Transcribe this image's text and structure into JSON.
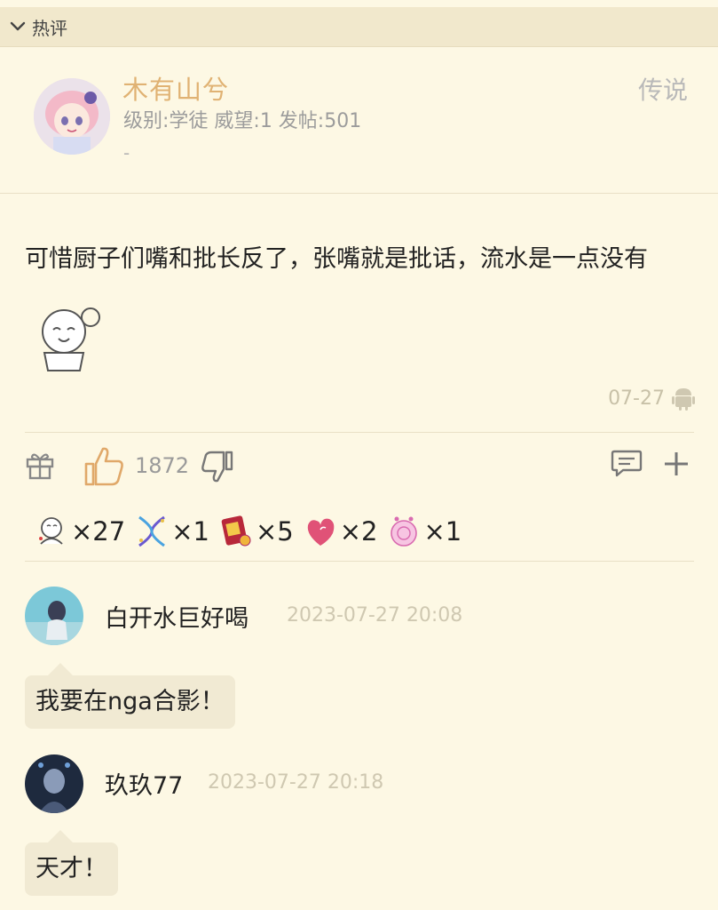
{
  "section": {
    "title": "热评"
  },
  "post": {
    "username": "木有山兮",
    "meta": "级别:学徒 威望:1 发帖:501",
    "extra": "-",
    "rank": "传说",
    "content": "可惜厨子们嘴和批长反了，张嘴就是批话，流水是一点没有",
    "date": "07-27",
    "likes": "1872"
  },
  "reactions": [
    {
      "icon": "doodle-face-icon",
      "count": "×27"
    },
    {
      "icon": "dna-helix-icon",
      "count": "×1"
    },
    {
      "icon": "red-book-icon",
      "count": "×5"
    },
    {
      "icon": "pink-heart-icon",
      "count": "×2"
    },
    {
      "icon": "pink-orb-icon",
      "count": "×1"
    }
  ],
  "replies": [
    {
      "name": "白开水巨好喝",
      "time": "2023-07-27 20:08",
      "text": "我要在nga合影！"
    },
    {
      "name": "玖玖77",
      "time": "2023-07-27 20:18",
      "text": "天才！"
    }
  ]
}
